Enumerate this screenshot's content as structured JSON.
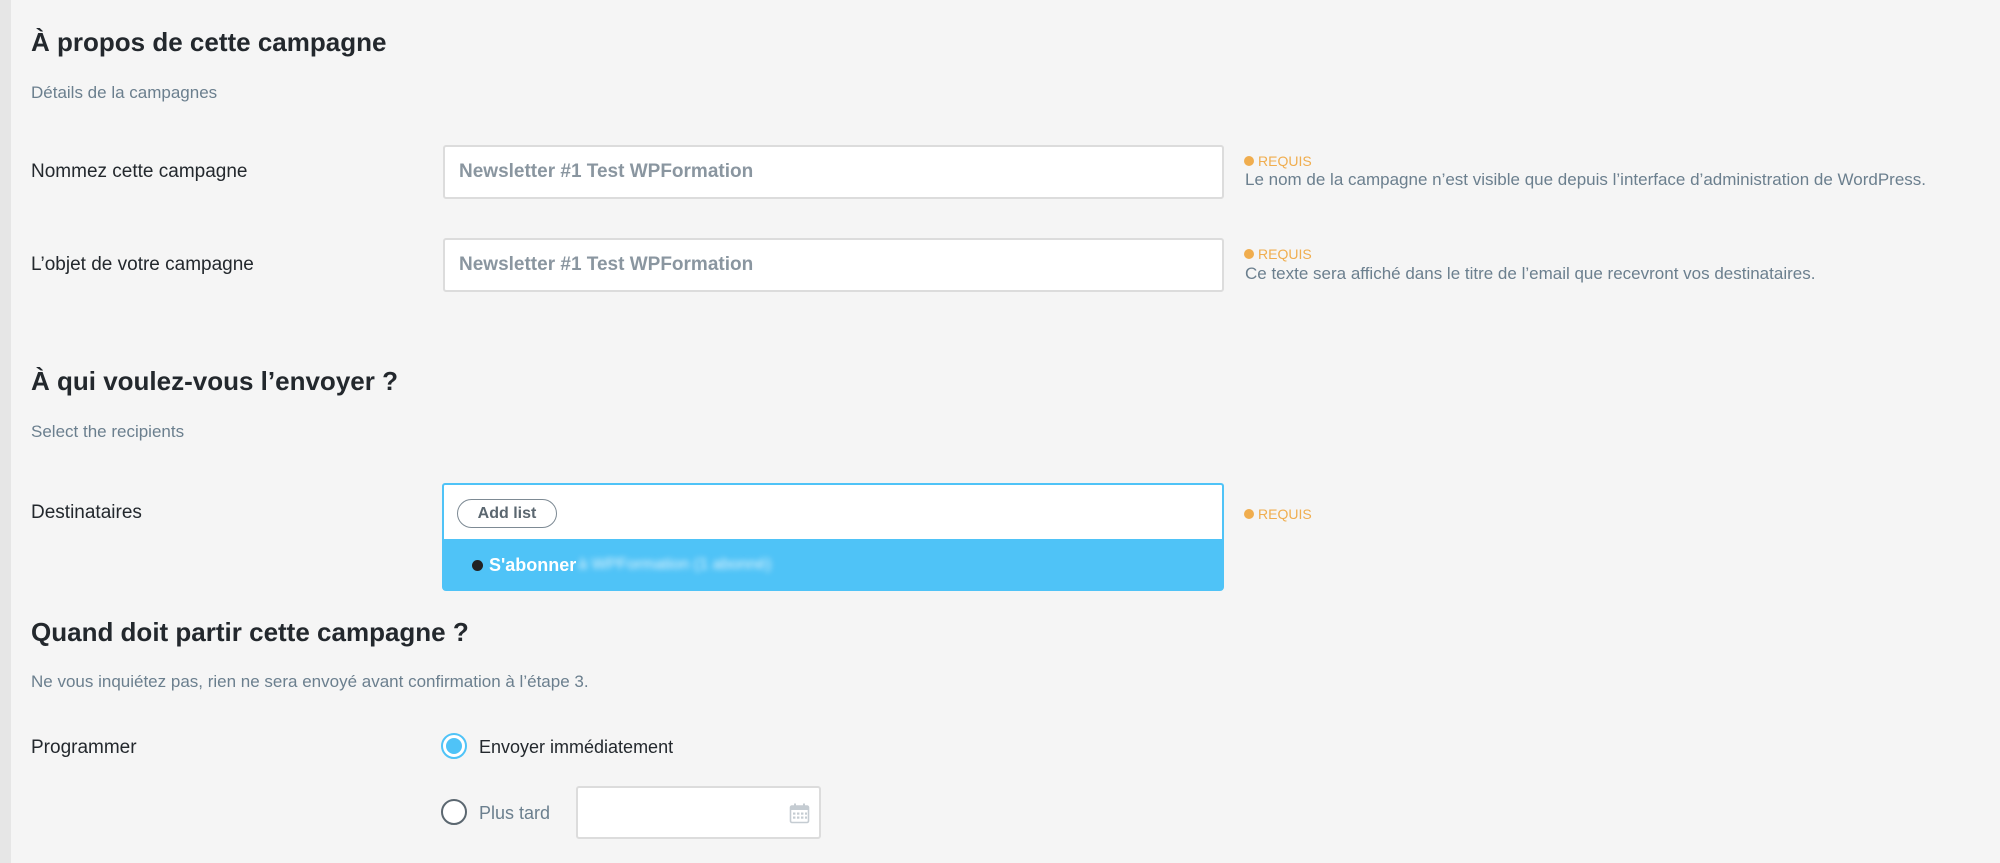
{
  "section_about": {
    "title": "À propos de cette campagne",
    "subtitle": "Détails de la campagnes",
    "name_field": {
      "label": "Nommez cette campagne",
      "value": "Newsletter #1 Test WPFormation",
      "required": "REQUIS",
      "help": "Le nom de la campagne n’est visible que depuis l’interface d’administration de WordPress."
    },
    "subject_field": {
      "label": "L’objet de votre campagne",
      "value": "Newsletter #1 Test WPFormation",
      "required": "REQUIS",
      "help": "Ce texte sera affiché dans le titre de l’email que recevront vos destinataires."
    }
  },
  "section_recipients": {
    "title": "À qui voulez-vous l’envoyer ?",
    "subtitle": "Select the recipients",
    "label": "Destinataires",
    "add_list": "Add list",
    "required": "REQUIS",
    "dropdown_option": "S'abonner",
    "dropdown_option_blurred": "à WPFormation (1 abonné)"
  },
  "section_schedule": {
    "title": "Quand doit partir cette campagne ?",
    "subtitle": "Ne vous inquiétez pas, rien ne sera envoyé avant confirmation à l’étape 3.",
    "label": "Programmer",
    "option_now": "Envoyer immédiatement",
    "option_later": "Plus tard",
    "date_value": ""
  },
  "colors": {
    "accent": "#4fc3f7",
    "required": "#f0ad4e",
    "muted_text": "#6b7f8e"
  }
}
